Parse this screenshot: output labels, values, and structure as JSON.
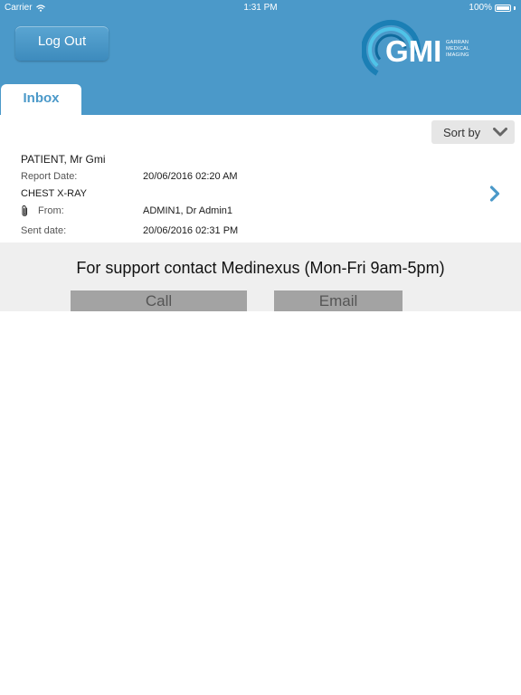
{
  "statusbar": {
    "carrier": "Carrier",
    "time": "1:31 PM",
    "battery": "100%"
  },
  "header": {
    "logout_label": "Log Out",
    "logo_mark": "GMI",
    "logo_lines": [
      "GARRAN",
      "MEDICAL",
      "IMAGING"
    ],
    "tab_label": "Inbox"
  },
  "toolbar": {
    "sort_label": "Sort by"
  },
  "message": {
    "patient": "PATIENT, Mr Gmi",
    "report_date_label": "Report Date:",
    "report_date": "20/06/2016 02:20 AM",
    "study": "CHEST X-RAY",
    "from_label": "From:",
    "from": "ADMIN1, Dr Admin1",
    "sent_label": "Sent date:",
    "sent": "20/06/2016 02:31 PM"
  },
  "support": {
    "text": "For support contact Medinexus (Mon-Fri 9am-5pm)",
    "call_label": "Call",
    "email_label": "Email"
  },
  "colors": {
    "header_bg": "#4b99c9",
    "accent": "#4b99c9",
    "support_bg": "#efefef",
    "button_bg": "#a3a3a3"
  }
}
